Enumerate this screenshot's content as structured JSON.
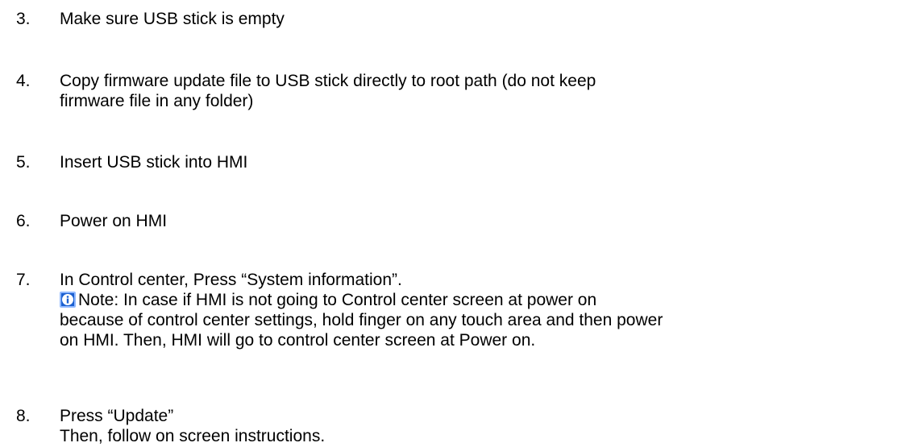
{
  "steps": [
    {
      "number": "3.",
      "lines": [
        "Make sure USB stick is empty"
      ]
    },
    {
      "number": "4.",
      "lines": [
        "Copy firmware update file to USB stick directly to root path (do not keep",
        "firmware file in any folder)"
      ]
    },
    {
      "number": "5.",
      "lines": [
        "Insert USB stick into HMI"
      ]
    },
    {
      "number": "6.",
      "lines": [
        "Power on HMI"
      ]
    },
    {
      "number": "7.",
      "lines": [
        "In Control center, Press “System information”."
      ],
      "note": {
        "icon": "info-icon",
        "lines": [
          "Note: In case if HMI is not going to Control center screen at power on",
          "because of control center settings, hold finger on any touch area and then power",
          "on HMI. Then, HMI will go to control center screen at Power on."
        ]
      }
    },
    {
      "number": "8.",
      "lines": [
        "Press “Update”",
        "Then, follow on screen instructions."
      ]
    }
  ]
}
